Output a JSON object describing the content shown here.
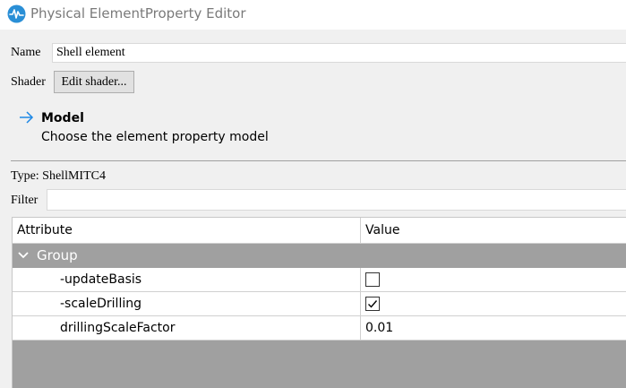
{
  "window": {
    "title": "Physical ElementProperty Editor"
  },
  "form": {
    "name_label": "Name",
    "name_value": "Shell element",
    "shader_label": "Shader",
    "shader_button": "Edit shader..."
  },
  "model": {
    "title": "Model",
    "subtitle": "Choose the element property model"
  },
  "type_text": "Type: ShellMITC4",
  "filter": {
    "label": "Filter",
    "value": ""
  },
  "table": {
    "headers": {
      "attribute": "Attribute",
      "value": "Value"
    },
    "group": "Group",
    "rows": [
      {
        "attribute": "-updateBasis",
        "kind": "checkbox",
        "checked": false
      },
      {
        "attribute": "-scaleDrilling",
        "kind": "checkbox",
        "checked": true
      },
      {
        "attribute": "drillingScaleFactor",
        "kind": "text",
        "value": "0.01"
      }
    ]
  },
  "colors": {
    "accent": "#1e88e5",
    "group_bg": "#a0a0a0",
    "window_bg": "#f0f0f0"
  }
}
